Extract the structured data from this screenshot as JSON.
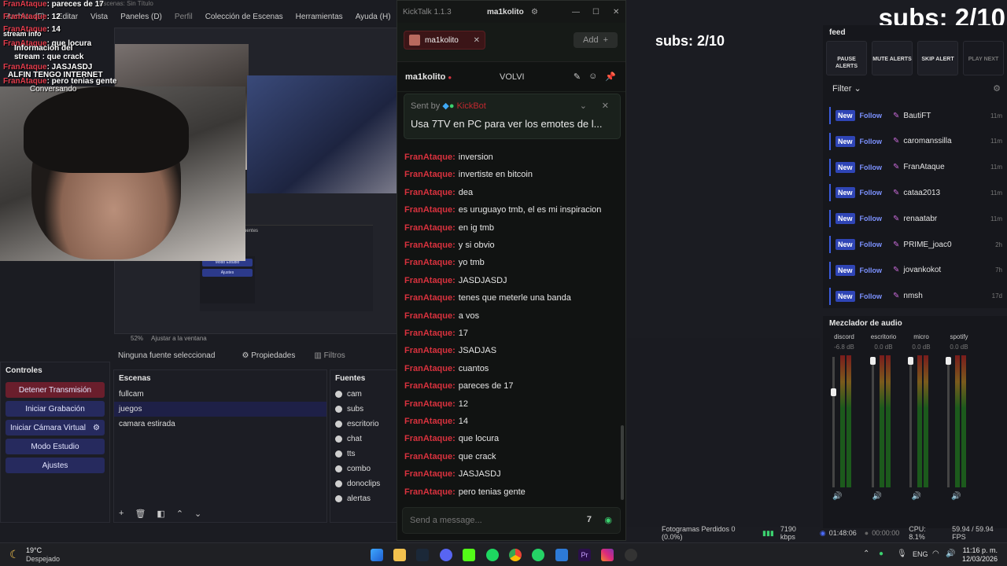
{
  "obs": {
    "title": "Escenas: Sin Título",
    "menu": [
      "Archivo (F)",
      "Editar",
      "Vista",
      "Paneles (D)",
      "Perfil",
      "Colección de Escenas",
      "Herramientas",
      "Ayuda (H)"
    ],
    "stream_info": "stream info",
    "stream_info_popup": "Información del stream : que crack",
    "overlay_msg": "ALFIN TENGO INTERNET",
    "overlay_chat": [
      {
        "user": "FranAtaque",
        "text": ": pareces de 17"
      },
      {
        "user": "FranAtaque",
        "text": ": 12"
      },
      {
        "user": "FranAtaque",
        "text": ": 14"
      },
      {
        "user": "FranAtaque",
        "text": ": que locura"
      },
      {
        "user": "FranAtaque",
        "text": ": que crack"
      },
      {
        "user": "FranAtaque",
        "text": ": JASJASDJ"
      },
      {
        "user": "FranAtaque",
        "text": ": pero tenias gente"
      }
    ],
    "conversando": "Conversando",
    "zoom": "52%",
    "fit": "Ajustar a la ventana",
    "no_source": "Ninguna fuente seleccionad",
    "properties": "Propiedades",
    "filters": "Filtros",
    "controls_title": "Controles",
    "controls": [
      "Detener Transmisión",
      "Iniciar Grabación",
      "Iniciar Cámara Virtual",
      "Modo Estudio",
      "Ajustes"
    ],
    "scenes_title": "Escenas",
    "scenes": [
      "fullcam",
      "juegos",
      "camara estirada"
    ],
    "sources_title": "Fuentes",
    "sources": [
      "cam",
      "subs",
      "escritorio",
      "chat",
      "tts",
      "combo",
      "donoclips",
      "alertas"
    ]
  },
  "kicktalk": {
    "app": "KickTalk 1.1.3",
    "window_channel": "ma1kolito",
    "tab": "ma1kolito",
    "add_label": "Add",
    "channel": "ma1kolito",
    "channel_second": "VOLVI",
    "pinned": {
      "sent_by": "Sent by",
      "bot": "KickBot",
      "message": "Usa 7TV en PC para ver los emotes de l..."
    },
    "messages": [
      {
        "user": "FranAtaque:",
        "text": "inversion"
      },
      {
        "user": "FranAtaque:",
        "text": "invertiste en bitcoin"
      },
      {
        "user": "FranAtaque:",
        "text": "dea"
      },
      {
        "user": "FranAtaque:",
        "text": "es uruguayo tmb, el es mi inspiracion"
      },
      {
        "user": "FranAtaque:",
        "text": "en ig tmb"
      },
      {
        "user": "FranAtaque:",
        "text": "y si obvio"
      },
      {
        "user": "FranAtaque:",
        "text": "yo tmb"
      },
      {
        "user": "FranAtaque:",
        "text": "JASDJASDJ"
      },
      {
        "user": "FranAtaque:",
        "text": "tenes que meterle una banda"
      },
      {
        "user": "FranAtaque:",
        "text": "a vos"
      },
      {
        "user": "FranAtaque:",
        "text": "17"
      },
      {
        "user": "FranAtaque:",
        "text": "JSADJAS"
      },
      {
        "user": "FranAtaque:",
        "text": "cuantos"
      },
      {
        "user": "FranAtaque:",
        "text": "pareces de 17"
      },
      {
        "user": "FranAtaque:",
        "text": "12"
      },
      {
        "user": "FranAtaque:",
        "text": "14"
      },
      {
        "user": "FranAtaque:",
        "text": "que locura"
      },
      {
        "user": "FranAtaque:",
        "text": "que crack"
      },
      {
        "user": "FranAtaque:",
        "text": "JASJASDJ"
      },
      {
        "user": "FranAtaque:",
        "text": "pero tenias gente"
      }
    ],
    "input_placeholder": "Send a message..."
  },
  "subs": "subs: 2/10",
  "feed": {
    "title": "feed",
    "buttons": [
      "PAUSE ALERTS",
      "MUTE ALERTS",
      "SKIP ALERT",
      "PLAY NEXT"
    ],
    "filter": "Filter",
    "new_label": "New",
    "follow_label": "Follow",
    "items": [
      {
        "user": "BautiFT",
        "time": "11m"
      },
      {
        "user": "caromanssilla",
        "time": "11m"
      },
      {
        "user": "FranAtaque",
        "time": "11m"
      },
      {
        "user": "cataa2013",
        "time": "11m"
      },
      {
        "user": "renaatabr",
        "time": "11m"
      },
      {
        "user": "PRIME_joac0",
        "time": "2h"
      },
      {
        "user": "jovankokot",
        "time": "7h"
      },
      {
        "user": "nmsh",
        "time": "17d"
      }
    ]
  },
  "mixer": {
    "title": "Mezclador de audio",
    "channels": [
      {
        "name": "discord",
        "db": "-6.8 dB"
      },
      {
        "name": "escritorio",
        "db": "0.0 dB"
      },
      {
        "name": "micro",
        "db": "0.0 dB"
      },
      {
        "name": "spotify",
        "db": "0.0 dB"
      }
    ],
    "scale": [
      "5",
      "0",
      "-5",
      "-10",
      "-15",
      "-20",
      "-25",
      "-30",
      "-35",
      "-40",
      "-45",
      "-50",
      "-55",
      "-60"
    ]
  },
  "status": {
    "dropped": "Fotogramas Perdidos 0 (0.0%)",
    "bitrate": "7190 kbps",
    "live_time": "01:48:06",
    "rec_time": "00:00:00",
    "cpu": "CPU: 8.1%",
    "fps": "59.94 / 59.94 FPS"
  },
  "taskbar": {
    "weather_temp": "19°C",
    "weather_desc": "Despejado",
    "lang": "ENG",
    "time": "11:16 p. m.",
    "date": "12/03/2026"
  }
}
